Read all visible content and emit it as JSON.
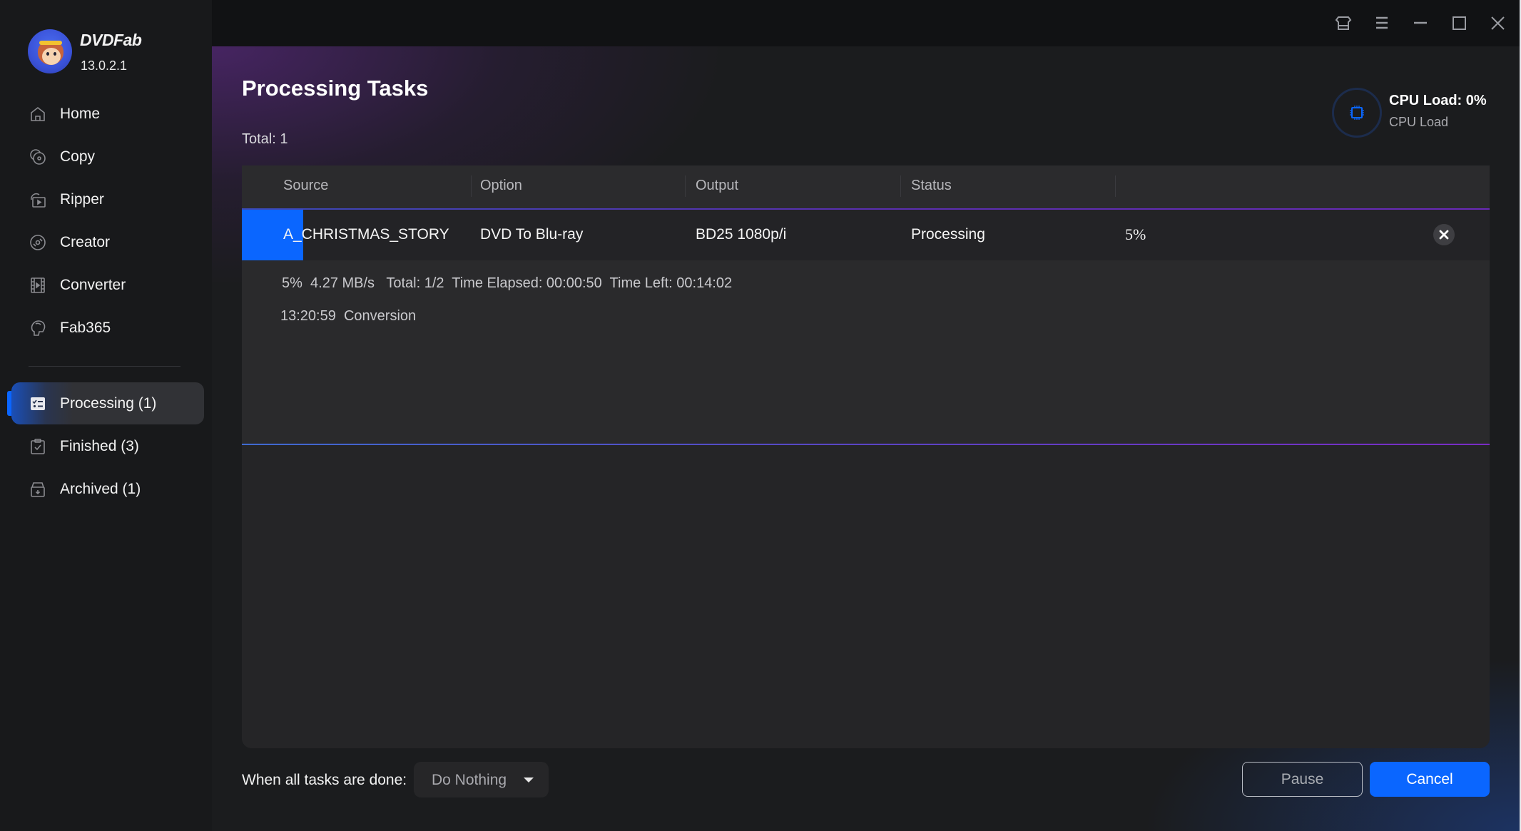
{
  "app": {
    "brand": "DVDFab",
    "version": "13.0.2.1"
  },
  "titlebar": {
    "buttons": [
      {
        "name": "skin-icon",
        "label": "Skin"
      },
      {
        "name": "menu-icon",
        "label": "Menu"
      },
      {
        "name": "minimize-icon",
        "label": "Minimize"
      },
      {
        "name": "maximize-icon",
        "label": "Maximize"
      },
      {
        "name": "close-icon",
        "label": "Close"
      }
    ]
  },
  "sidebar": {
    "nav": [
      {
        "label": "Home",
        "icon": "home-icon"
      },
      {
        "label": "Copy",
        "icon": "copy-disc-icon"
      },
      {
        "label": "Ripper",
        "icon": "ripper-icon"
      },
      {
        "label": "Creator",
        "icon": "creator-disc-icon"
      },
      {
        "label": "Converter",
        "icon": "film-icon"
      },
      {
        "label": "Fab365",
        "icon": "fab365-icon"
      }
    ],
    "tasks": [
      {
        "label": "Processing (1)",
        "icon": "task-list-icon",
        "active": true
      },
      {
        "label": "Finished (3)",
        "icon": "clipboard-check-icon",
        "active": false
      },
      {
        "label": "Archived (1)",
        "icon": "archive-box-icon",
        "active": false
      }
    ]
  },
  "main": {
    "title": "Processing Tasks",
    "total": "Total: 1",
    "cpu": {
      "title": "CPU Load: 0%",
      "subtitle": "CPU Load",
      "icon": "cpu-chip-icon",
      "accent": "#0a66ff"
    },
    "table": {
      "headers": [
        "Source",
        "Option",
        "Output",
        "Status",
        ""
      ],
      "rows": [
        {
          "source": "A_CHRISTMAS_STORY",
          "option": "DVD To Blu-ray",
          "output": "BD25 1080p/i",
          "status": "Processing",
          "percent": "5%",
          "progress_fraction": 0.05,
          "details": {
            "line1": "5%  4.27 MB/s   Total: 1/2  Time Elapsed: 00:00:50  Time Left: 00:14:02",
            "line2": "13:20:59  Conversion"
          }
        }
      ]
    }
  },
  "footer": {
    "when_done_label": "When all tasks are done:",
    "when_done_value": "Do Nothing",
    "pause_label": "Pause",
    "cancel_label": "Cancel",
    "accent_color": "#0a66ff"
  }
}
